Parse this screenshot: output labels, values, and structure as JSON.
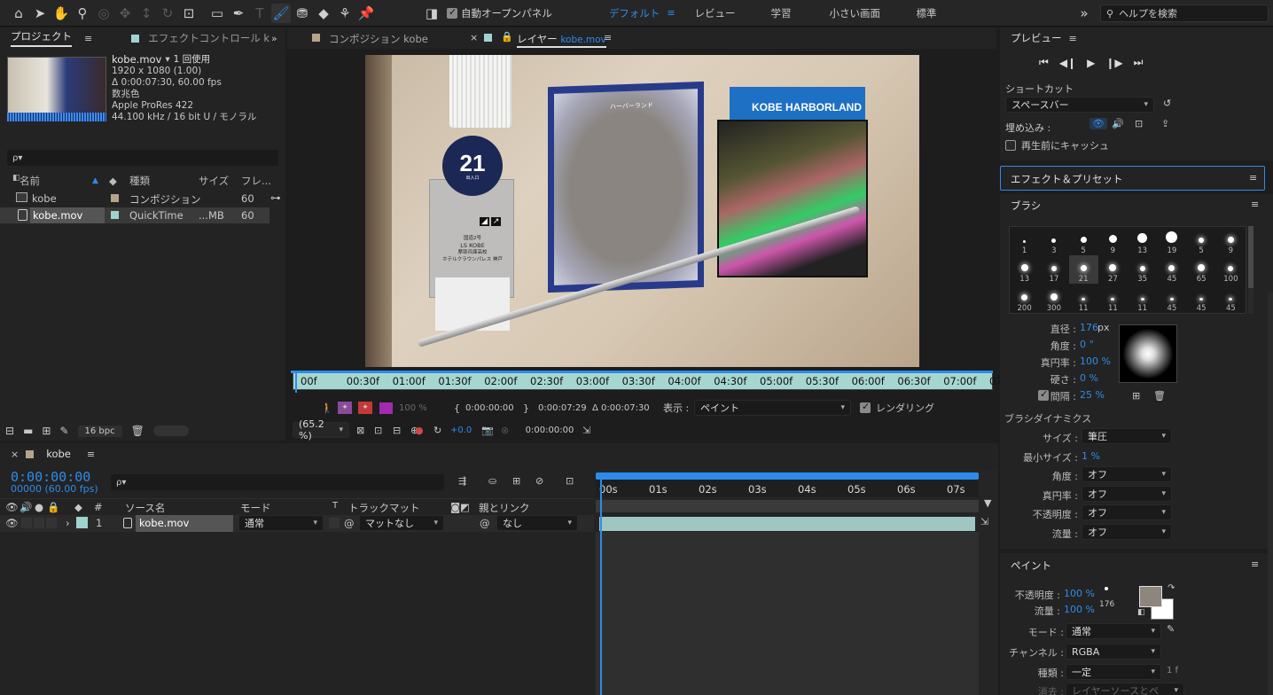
{
  "toolbar": {
    "auto_open_panel": "自動オープンパネル",
    "workspaces": [
      "デフォルト",
      "レビュー",
      "学習",
      "小さい画面",
      "標準"
    ],
    "help_search_placeholder": "ヘルプを検索"
  },
  "project_panel": {
    "tab_project": "プロジェクト",
    "tab_effect_controls": "エフェクトコントロール k",
    "selected_name": "kobe.mov",
    "selected_usage": "1 回使用",
    "info_lines": [
      "1920 x 1080 (1.00)",
      "Δ 0:00:07:30, 60.00 fps",
      "数兆色",
      "Apple ProRes 422",
      "44.100 kHz / 16 bit U / モノラル"
    ],
    "search_placeholder": "ρ▾",
    "columns": [
      "名前",
      "種類",
      "サイズ",
      "フレ..."
    ],
    "items": [
      {
        "name": "kobe",
        "type": "コンポジション",
        "size": "",
        "fps": "60",
        "color": "#b5a48a"
      },
      {
        "name": "kobe.mov",
        "type": "QuickTime",
        "size": "...MB",
        "fps": "60",
        "color": "#9fd3cf"
      }
    ],
    "bpc": "16 bpc"
  },
  "viewer": {
    "tab_comp": "コンポジション kobe",
    "tab_layer_prefix": "レイヤー",
    "tab_layer_name": "kobe.mov",
    "ruler_ticks": [
      "00f",
      "00:30f",
      "01:00f",
      "01:30f",
      "02:00f",
      "02:30f",
      "03:00f",
      "03:30f",
      "04:00f",
      "04:30f",
      "05:00f",
      "05:30f",
      "06:00f",
      "06:30f",
      "07:00f",
      "07:3"
    ],
    "opacity": "100 %",
    "in_time": "0:00:00:00",
    "out_time": "0:00:07:29",
    "duration": "Δ 0:00:07:30",
    "display_label": "表示 :",
    "display_value": "ペイント",
    "rendering_label": "レンダリング",
    "zoom": "(65.2 %)",
    "exposure": "+0.0",
    "current_time": "0:00:00:00",
    "image": {
      "sign_number": "21",
      "sign_sub": "出入口",
      "sign_lines": [
        "国道2号",
        "LS KOBE",
        "摩耶兵庫高校",
        "ホテルクラウンパレス 神戸"
      ],
      "board_center_label": "ハーバーランド",
      "board_right_title": "KOBE HARBORLAND"
    }
  },
  "timeline": {
    "tab_name": "kobe",
    "timecode": "0:00:00:00",
    "frames": "00000 (60.00 fps)",
    "columns": [
      "#",
      "ソース名",
      "モード",
      "T",
      "トラックマット",
      "親とリンク"
    ],
    "ruler_ticks": [
      "00s",
      "01s",
      "02s",
      "03s",
      "04s",
      "05s",
      "06s",
      "07s"
    ],
    "layer": {
      "index": "1",
      "name": "kobe.mov",
      "mode": "通常",
      "matte": "マットなし",
      "parent": "なし"
    }
  },
  "preview_panel": {
    "title": "プレビュー",
    "shortcut_label": "ショートカット",
    "shortcut_value": "スペースバー",
    "embed_label": "埋め込み :",
    "cache_label": "再生前にキャッシュ"
  },
  "effects_panel": {
    "title": "エフェクト＆プリセット"
  },
  "brush_panel": {
    "title": "ブラシ",
    "brush_sizes": [
      "1",
      "3",
      "5",
      "9",
      "13",
      "19",
      "5",
      "9",
      "13",
      "17",
      "21",
      "27",
      "35",
      "45",
      "65",
      "100",
      "200",
      "300",
      "11",
      "11",
      "11",
      "45",
      "45",
      "45"
    ],
    "diameter_label": "直径 :",
    "diameter": "176",
    "diameter_unit": "px",
    "angle_label": "角度 :",
    "angle": "0 °",
    "roundness_label": "真円率 :",
    "roundness": "100 %",
    "hardness_label": "硬さ :",
    "hardness": "0 %",
    "spacing_label": "間隔 :",
    "spacing": "25 %",
    "dynamics_title": "ブラシダイナミクス",
    "dyn": [
      {
        "label": "サイズ :",
        "value": "筆圧"
      },
      {
        "label": "最小サイズ :",
        "value": "1 %"
      },
      {
        "label": "角度 :",
        "value": "オフ"
      },
      {
        "label": "真円率 :",
        "value": "オフ"
      },
      {
        "label": "不透明度 :",
        "value": "オフ"
      },
      {
        "label": "流量 :",
        "value": "オフ"
      }
    ]
  },
  "paint_panel": {
    "title": "ペイント",
    "opacity_label": "不透明度 :",
    "opacity": "100 %",
    "flow_label": "流量 :",
    "flow": "100 %",
    "brush_size": "176",
    "fg_color": "#8e857d",
    "mode_label": "モード :",
    "mode": "通常",
    "channel_label": "チャンネル :",
    "channel": "RGBA",
    "type_label": "種類 :",
    "type": "一定",
    "type_suffix": "1 f",
    "erase_label": "消去 :",
    "erase": "レイヤーソースとペ"
  }
}
